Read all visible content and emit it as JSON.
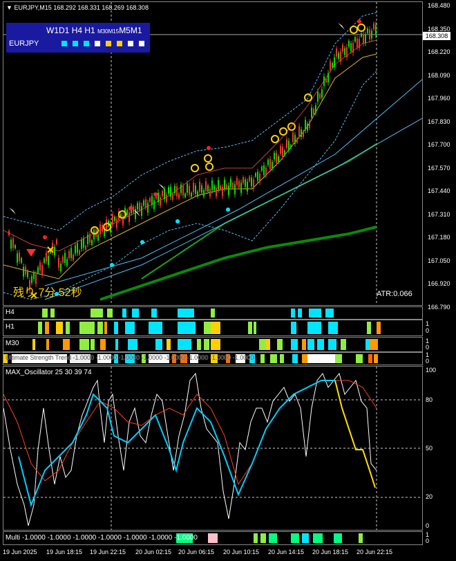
{
  "header": {
    "symbol_tf": "EURJPY,M15",
    "ohlc": "168.292 168.331 168.269 168.308"
  },
  "timeframe_box": {
    "row1": [
      "W1",
      "D1",
      "H4",
      "H1",
      "M30",
      "M15",
      "M5",
      "M1"
    ],
    "symbol": "EURJPY",
    "squares": [
      "#00e5ff",
      "#00e5ff",
      "#00e5ff",
      "#ffffff",
      "#ffd000",
      "#ffd000",
      "#ffffff",
      "#ffffff"
    ]
  },
  "price_axis": [
    "168.480",
    "168.350",
    "168.220",
    "168.090",
    "167.960",
    "167.830",
    "167.700",
    "167.570",
    "167.440",
    "167.310",
    "167.180",
    "167.050",
    "166.920",
    "166.790"
  ],
  "current_price": "168.308",
  "countdown": "残り 7分 52秒",
  "atr_label": "ATR:0.066",
  "panels": {
    "h4": {
      "label": "H4"
    },
    "h1": {
      "label": "H1",
      "scale_top": "1",
      "scale_bottom": "0"
    },
    "m30": {
      "label": "M30",
      "scale_top": "1",
      "scale_bottom": "0"
    },
    "ultimate": {
      "label": "Ultimate Strength Trend -1.0000 -1.0000 -1.0000 -1.0000 -1.0000 -1.0000 -1.0000 -1.0000",
      "scale_top": "1",
      "scale_bottom": "0"
    },
    "oscillator": {
      "label": "MAX_Oscillator 25 30 39 74",
      "scale": [
        "100",
        "80",
        "50",
        "20",
        "0"
      ]
    },
    "multi": {
      "label": "Multi -1.0000 -1.0000 -1.0000 -1.0000 -1.0000 -1.0000 -1.0000",
      "scale_top": "1",
      "scale_bottom": "0"
    }
  },
  "time_axis": [
    "19 Jun 2025",
    "19 Jun 18:15",
    "19 Jun 22:15",
    "20 Jun 02:15",
    "20 Jun 06:15",
    "20 Jun 10:15",
    "20 Jun 14:15",
    "20 Jun 18:15",
    "20 Jun 22:15"
  ],
  "colors": {
    "bull": "#00e000",
    "bear": "#ff3030",
    "cyan": "#00e5ff",
    "lightgreen": "#90ee40",
    "orange": "#ff9900",
    "yellow": "#ffd000"
  }
}
